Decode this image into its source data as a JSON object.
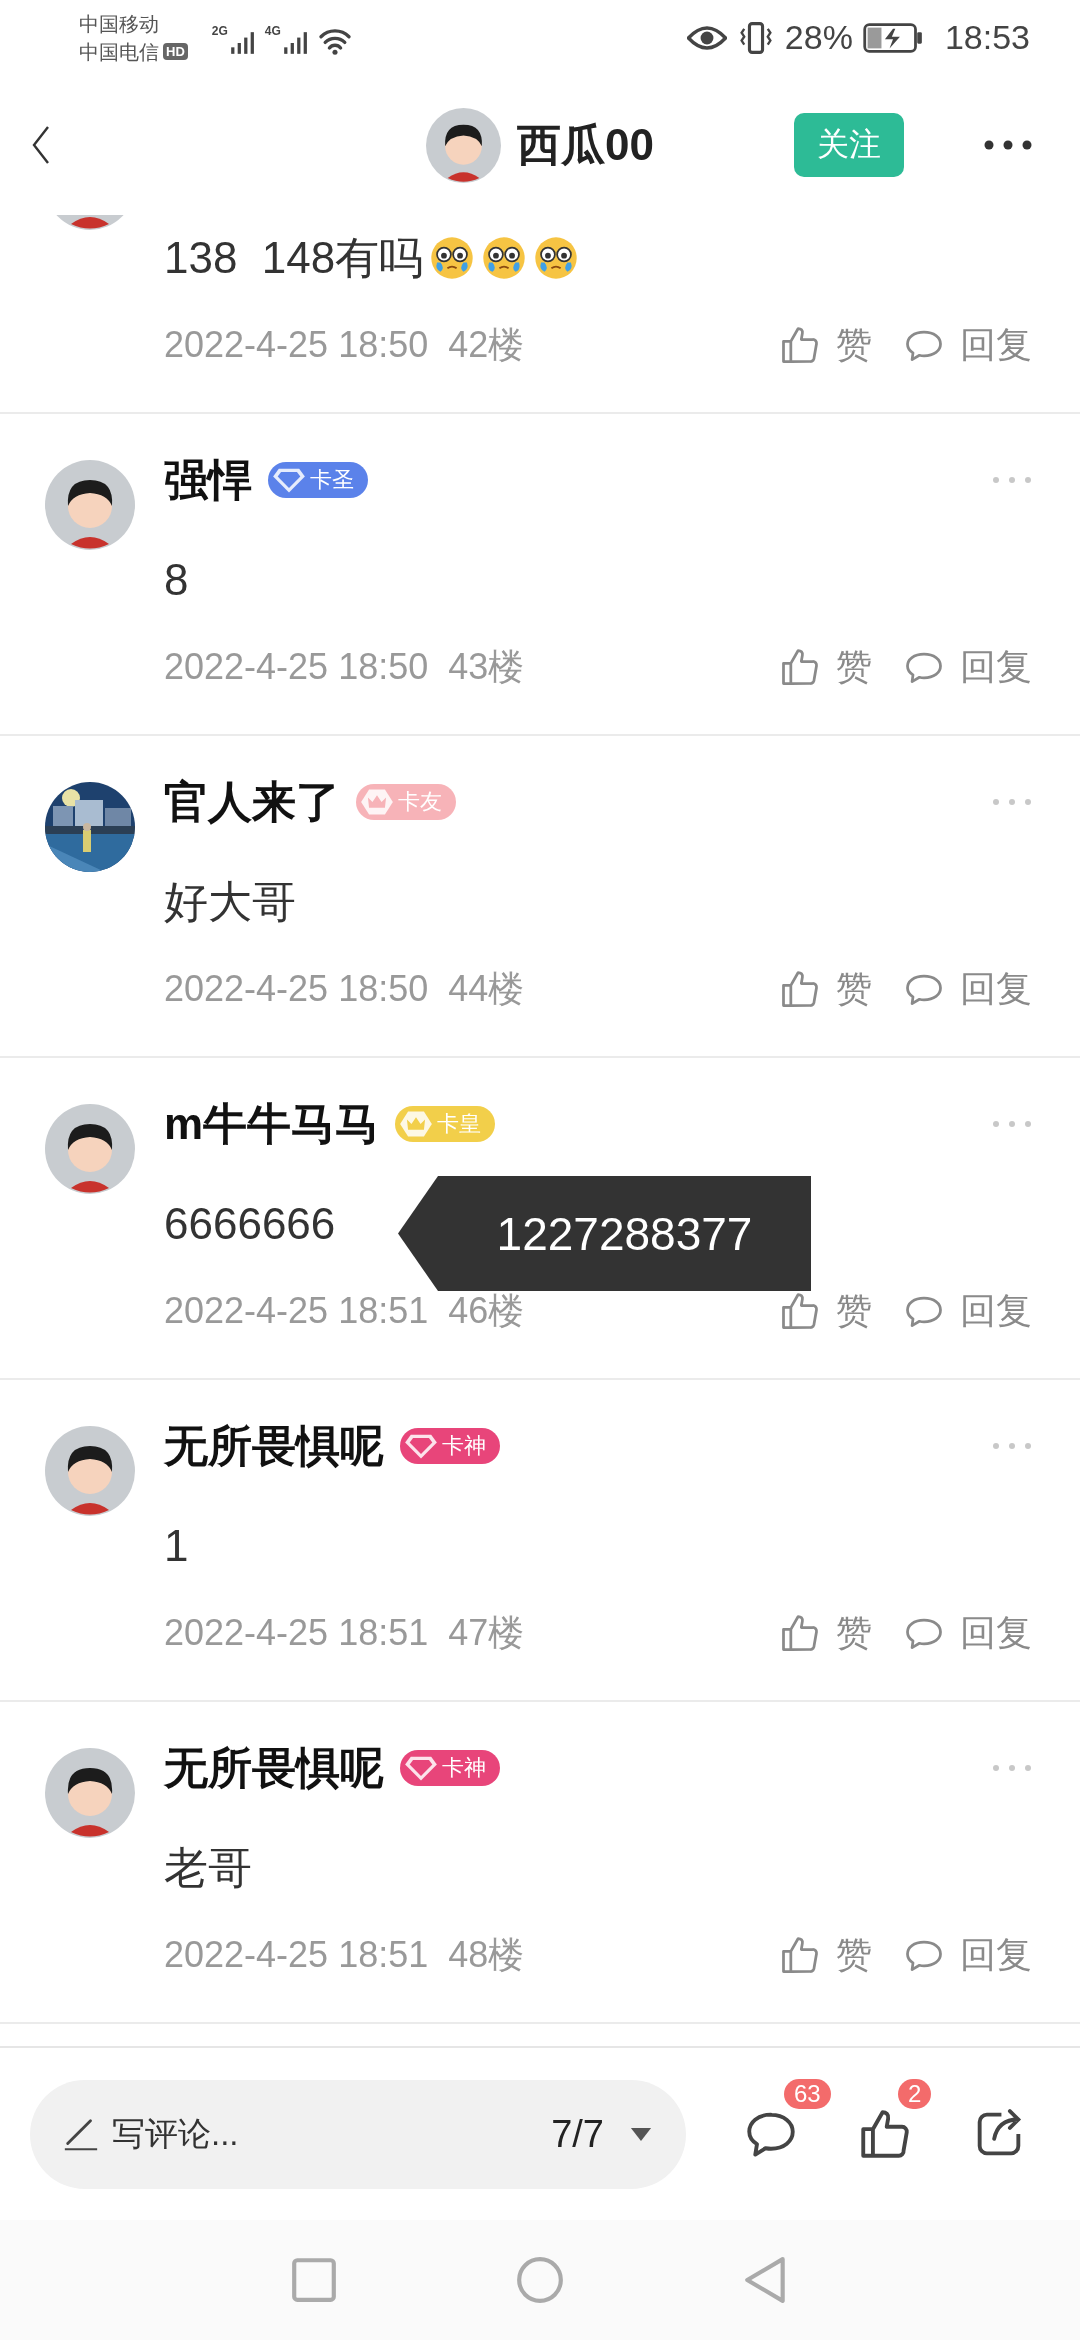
{
  "status_bar": {
    "carriers": [
      "中国移动",
      "中国电信"
    ],
    "hd_label": "HD",
    "networks": [
      "2G",
      "4G"
    ],
    "battery": "28%",
    "time": "18:53"
  },
  "header": {
    "avatar": {
      "kind": "cartoon"
    },
    "title": "西瓜00",
    "follow": "关注"
  },
  "comments": [
    {
      "partial": true,
      "avatar": {
        "kind": "cartoon"
      },
      "content": "138  148有吗",
      "emojis": [
        {
          "kind": "teary"
        },
        {
          "kind": "teary"
        },
        {
          "kind": "teary"
        }
      ],
      "time": "2022-4-25 18:50",
      "floor": "42楼",
      "like": "赞",
      "reply": "回复"
    },
    {
      "partial": false,
      "avatar": {
        "kind": "cartoon"
      },
      "name": "强悍",
      "badge": {
        "label": "卡圣",
        "kind": "diamond",
        "color": "#5b82ea"
      },
      "content": "8",
      "time": "2022-4-25 18:50",
      "floor": "43楼",
      "like": "赞",
      "reply": "回复"
    },
    {
      "partial": false,
      "name": "官人来了",
      "badge": {
        "label": "卡友",
        "kind": "crown",
        "color": "#f7b3b8"
      },
      "content": "好大哥",
      "time": "2022-4-25 18:50",
      "floor": "44楼",
      "like": "赞",
      "reply": "回复"
    },
    {
      "partial": false,
      "avatar": {
        "kind": "cartoon"
      },
      "name": "m牛牛马马",
      "badge": {
        "label": "卡皇",
        "kind": "crown",
        "color": "#f2cf4a"
      },
      "content": "6666666",
      "time": "2022-4-25 18:51",
      "floor": "46楼",
      "like": "赞",
      "reply": "回复",
      "tooltip": "1227288377"
    },
    {
      "partial": false,
      "avatar": {
        "kind": "cartoon"
      },
      "name": "无所畏惧呢",
      "badge": {
        "label": "卡神",
        "kind": "diamond",
        "color": "#e8457a"
      },
      "content": "1",
      "time": "2022-4-25 18:51",
      "floor": "47楼",
      "like": "赞",
      "reply": "回复"
    },
    {
      "partial": false,
      "avatar": {
        "kind": "cartoon"
      },
      "name": "无所畏惧呢",
      "badge": {
        "label": "卡神",
        "kind": "diamond",
        "color": "#e8457a"
      },
      "content": "老哥",
      "time": "2022-4-25 18:51",
      "floor": "48楼",
      "like": "赞",
      "reply": "回复"
    }
  ],
  "bottom_bar": {
    "placeholder": "写评论...",
    "page": "7/7",
    "comment_count": "63",
    "like_count": "2"
  }
}
